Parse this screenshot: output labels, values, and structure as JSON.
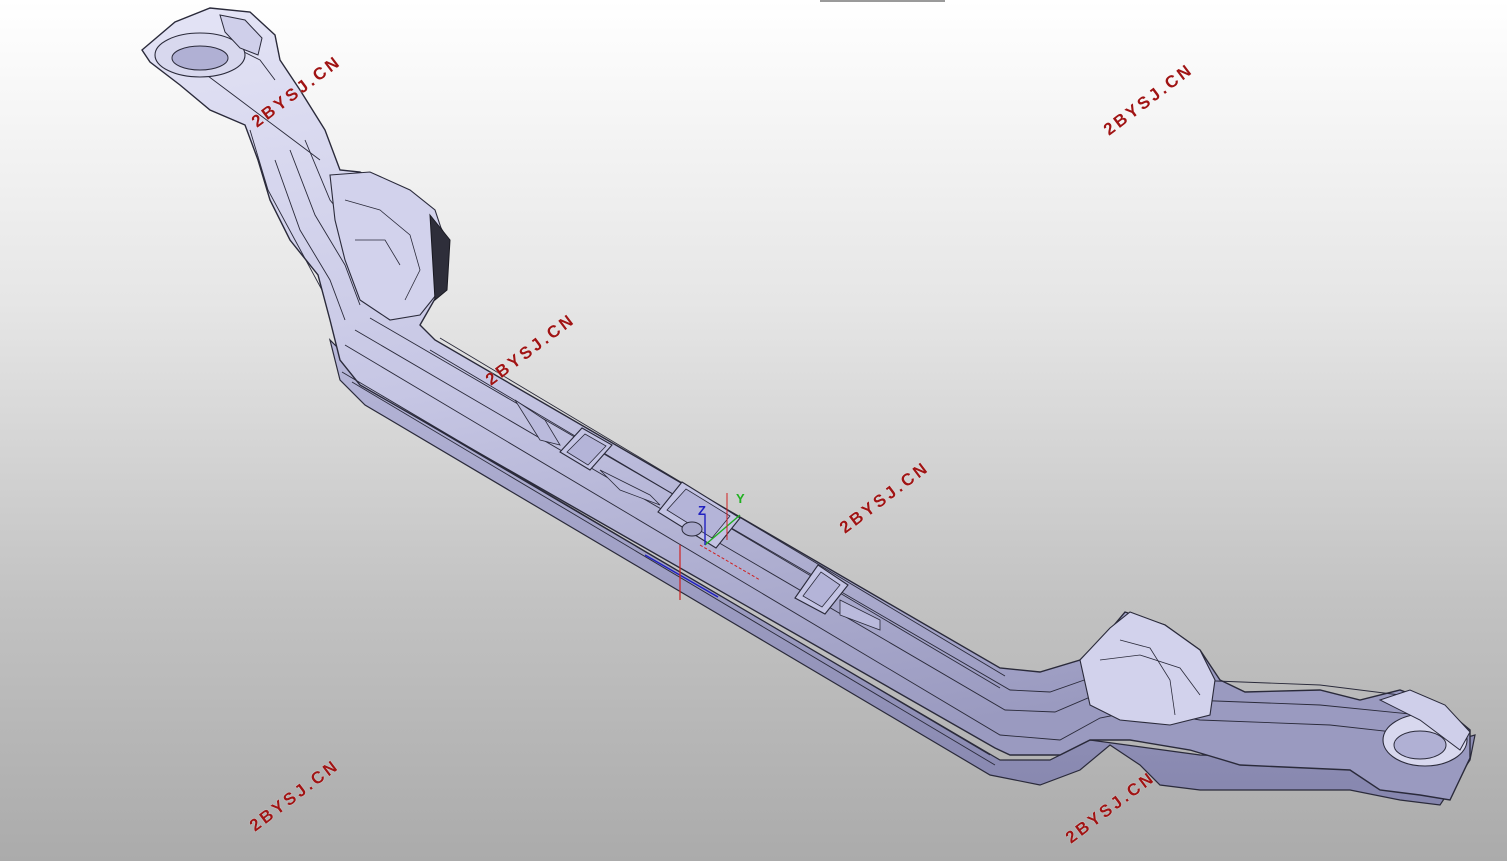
{
  "watermark": {
    "text": "2BYSJ.CN",
    "color": "#a01414"
  },
  "watermarks": [
    {
      "text": "2BYSJ.CN"
    },
    {
      "text": "2BYSJ.CN"
    },
    {
      "text": "2BYSJ.CN"
    },
    {
      "text": "2BYSJ.CN"
    },
    {
      "text": "2BYSJ.CN"
    },
    {
      "text": "2BYSJ.CN"
    }
  ],
  "compass": {
    "z_label": "Z",
    "y_label": "Y",
    "z_color": "#2020c0",
    "y_color": "#20b020",
    "x_color": "#d02020"
  },
  "model": {
    "part_fill": "#c8c8e8",
    "part_shadow": "#8e8eb4",
    "edge_color": "#2a2a3a"
  }
}
